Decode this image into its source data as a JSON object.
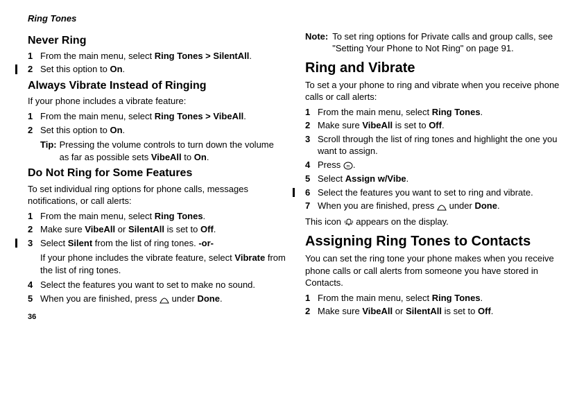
{
  "pageHeader": "Ring Tones",
  "pageNumber": "36",
  "left": {
    "h_never": "Never Ring",
    "never_1a": "From the main menu, select ",
    "never_1b": "Ring Tones > SilentAll",
    "never_1c": ".",
    "never_2a": "Set this option to ",
    "never_2b": "On",
    "never_2c": ".",
    "h_always": "Always Vibrate Instead of Ringing",
    "always_intro": "If your phone includes a vibrate feature:",
    "always_1a": "From the main menu, select ",
    "always_1b": "Ring Tones > VibeAll",
    "always_1c": ".",
    "always_2a": "Set this option to ",
    "always_2b": "On",
    "always_2c": ".",
    "tip_lbl": "Tip:",
    "tip_a": "Pressing the volume controls to turn down the volume as far as possible sets ",
    "tip_b": "VibeAll",
    "tip_c": " to ",
    "tip_d": "On",
    "tip_e": ".",
    "h_donot": "Do Not Ring for Some Features",
    "donot_intro": "To set individual ring options for phone calls, messages notifications, or call alerts:",
    "donot_1a": "From the main menu, select ",
    "donot_1b": "Ring Tones",
    "donot_1c": ".",
    "donot_2a": "Make sure ",
    "donot_2b": "VibeAll",
    "donot_2c": " or ",
    "donot_2d": "SilentAll",
    "donot_2e": " is set to ",
    "donot_2f": "Off",
    "donot_2g": ".",
    "donot_3a": "Select ",
    "donot_3b": "Silent",
    "donot_3c": " from the list of ring tones. ",
    "donot_3d": "-or-",
    "donot_3sub_a": "If your phone includes the vibrate feature, select ",
    "donot_3sub_b": "Vibrate",
    "donot_3sub_c": " from the list of ring tones.",
    "donot_4": "Select the features you want to set to make no sound.",
    "donot_5a": "When you are finished, press ",
    "donot_5b": " under ",
    "donot_5c": "Done",
    "donot_5d": "."
  },
  "right": {
    "note_lbl": "Note:",
    "note_txt": "To set ring options for Private calls and group calls, see \"Setting Your Phone to Not Ring\" on page 91.",
    "h_ringvib": "Ring and Vibrate",
    "ringvib_intro": "To set a your phone to ring and vibrate when you receive phone calls or call alerts:",
    "rv_1a": "From the main menu, select ",
    "rv_1b": "Ring Tones",
    "rv_1c": ".",
    "rv_2a": "Make sure ",
    "rv_2b": "VibeAll",
    "rv_2c": " is set to ",
    "rv_2d": "Off",
    "rv_2e": ".",
    "rv_3": "Scroll through the list of ring tones and highlight the one you want to assign.",
    "rv_4a": "Press ",
    "rv_4b": ".",
    "rv_5a": "Select ",
    "rv_5b": "Assign w/Vibe",
    "rv_5c": ".",
    "rv_6": "Select the features you want to set to ring and vibrate.",
    "rv_7a": "When you are finished, press ",
    "rv_7b": " under ",
    "rv_7c": "Done",
    "rv_7d": ".",
    "rv_after_a": "This icon ",
    "rv_after_b": " appears on the display.",
    "h_assign": "Assigning Ring Tones to Contacts",
    "assign_intro": "You can set the ring tone your phone makes when you receive phone calls or call alerts from someone you have stored in Contacts.",
    "as_1a": "From the main menu, select ",
    "as_1b": "Ring Tones",
    "as_1c": ".",
    "as_2a": "Make sure ",
    "as_2b": "VibeAll",
    "as_2c": " or ",
    "as_2d": "SilentAll",
    "as_2e": " is set to ",
    "as_2f": "Off",
    "as_2g": "."
  }
}
